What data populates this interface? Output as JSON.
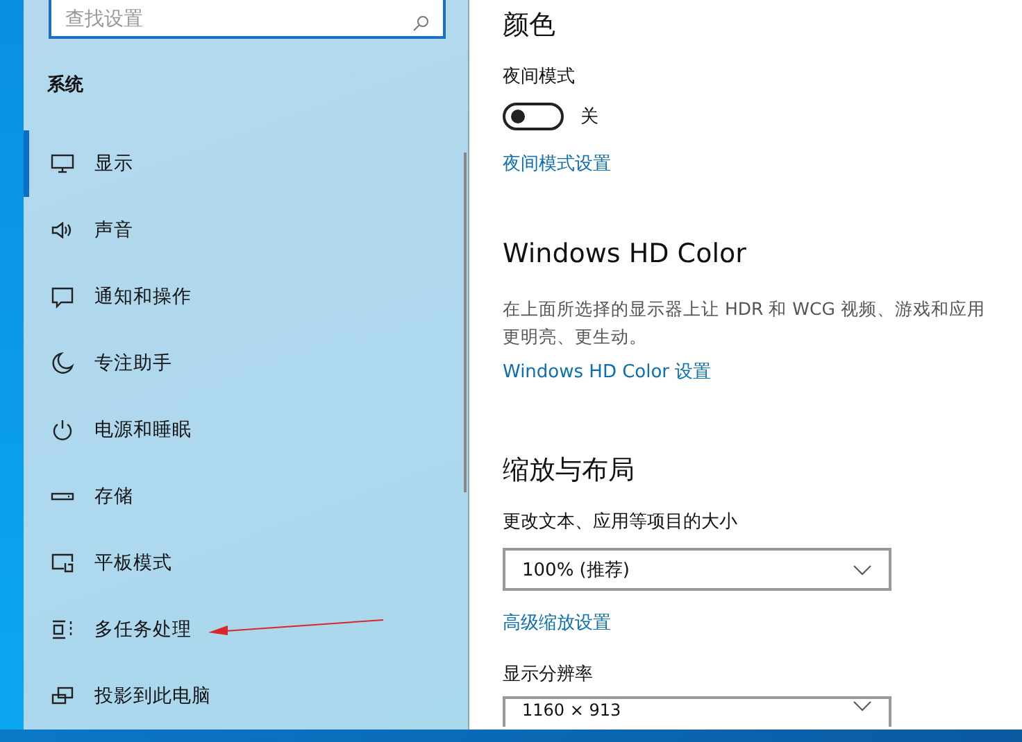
{
  "sidebar": {
    "search": {
      "placeholder": "查找设置"
    },
    "heading": "系统",
    "items": [
      {
        "label": "显示",
        "selected": true
      },
      {
        "label": "声音",
        "selected": false
      },
      {
        "label": "通知和操作",
        "selected": false
      },
      {
        "label": "专注助手",
        "selected": false
      },
      {
        "label": "电源和睡眠",
        "selected": false
      },
      {
        "label": "存储",
        "selected": false
      },
      {
        "label": "平板模式",
        "selected": false
      },
      {
        "label": "多任务处理",
        "selected": false
      },
      {
        "label": "投影到此电脑",
        "selected": false
      }
    ]
  },
  "content": {
    "color_heading": "颜色",
    "night_label": "夜间模式",
    "night_toggle": {
      "on": false,
      "state_text": "关"
    },
    "night_link": "夜间模式设置",
    "hd_heading": "Windows HD Color",
    "hd_description": [
      "在上面所选择的显示器上让 HDR 和 WCG 视频、游戏和应用",
      "更明亮、更生动。"
    ],
    "hd_link": "Windows HD Color 设置",
    "scale_heading": "缩放与布局",
    "scale_label": "更改文本、应用等项目的大小",
    "scale_value": "100% (推荐)",
    "scale_link": "高级缩放设置",
    "resolution_label": "显示分辨率",
    "resolution_value": "1160 × 913"
  }
}
